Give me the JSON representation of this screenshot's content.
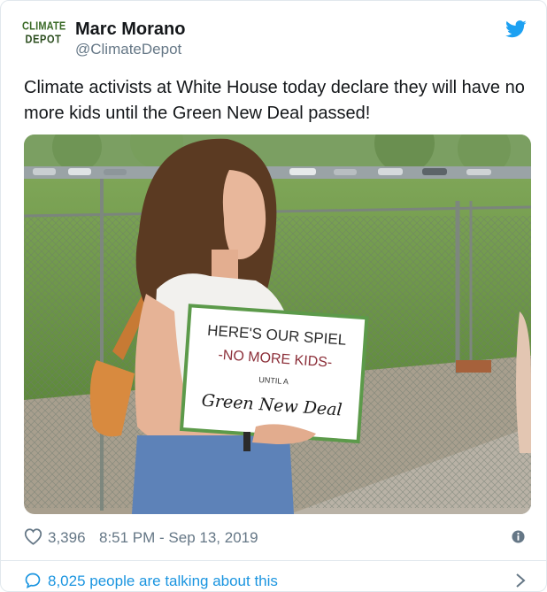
{
  "author": {
    "logo_line1": "CLIMATE",
    "logo_line2": "DEPOT",
    "name": "Marc Morano",
    "handle": "@ClimateDepot"
  },
  "tweet": {
    "text": "Climate activists at White House today declare they will have no more kids until the Green New Deal passed!"
  },
  "photo": {
    "sign_line1": "HERE'S OUR SPIEL",
    "sign_line2": "-NO MORE KIDS-",
    "sign_line3": "UNTIL A",
    "sign_line4": "Green New Deal"
  },
  "meta": {
    "likes": "3,396",
    "timestamp": "8:51 PM - Sep 13, 2019"
  },
  "footer": {
    "talking": "8,025 people are talking about this"
  },
  "colors": {
    "link_blue": "#1b95e0",
    "twitter_blue": "#1da1f2",
    "muted": "#657786"
  },
  "icons": [
    "twitter-bird-icon",
    "heart-icon",
    "info-icon",
    "chat-bubble-icon",
    "chevron-right-icon"
  ]
}
